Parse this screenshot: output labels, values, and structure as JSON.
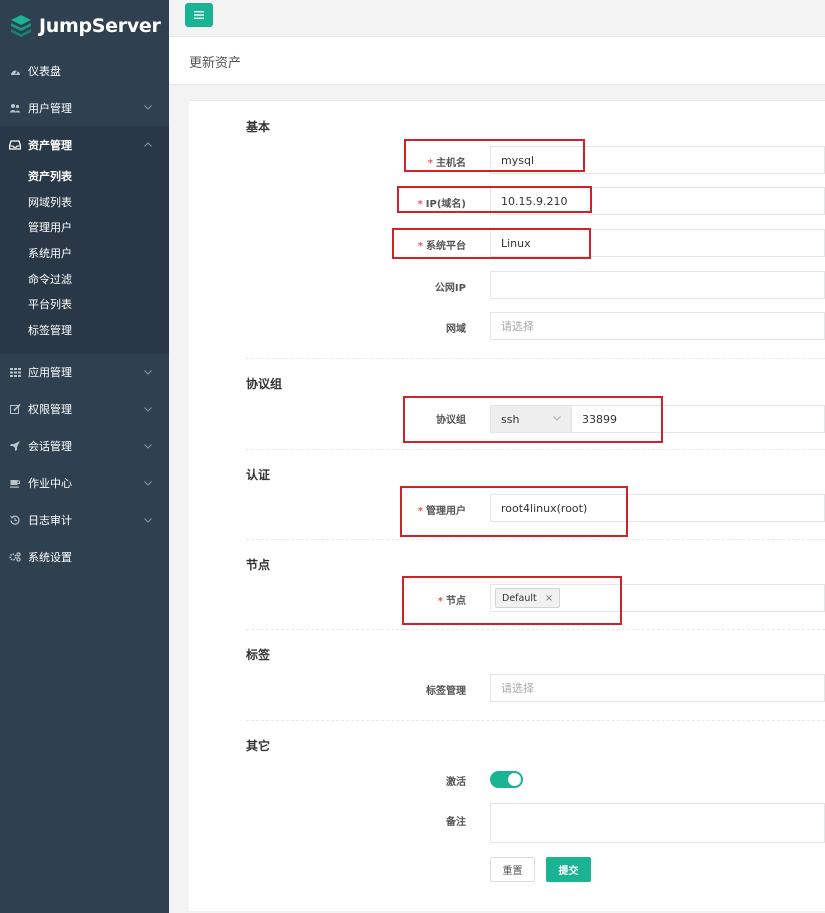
{
  "app": {
    "name": "JumpServer"
  },
  "sidebar": {
    "items": [
      {
        "label": "仪表盘",
        "icon": "dashboard-icon"
      },
      {
        "label": "用户管理",
        "icon": "users-icon",
        "expandable": true
      },
      {
        "label": "资产管理",
        "icon": "inbox-icon",
        "expandable": true,
        "expanded": true,
        "children": [
          "资产列表",
          "网域列表",
          "管理用户",
          "系统用户",
          "命令过滤",
          "平台列表",
          "标签管理"
        ],
        "current": "资产列表"
      },
      {
        "label": "应用管理",
        "icon": "grid-icon",
        "expandable": true
      },
      {
        "label": "权限管理",
        "icon": "edit-icon",
        "expandable": true
      },
      {
        "label": "会话管理",
        "icon": "rocket-icon",
        "expandable": true
      },
      {
        "label": "作业中心",
        "icon": "coffee-icon",
        "expandable": true
      },
      {
        "label": "日志审计",
        "icon": "history-icon",
        "expandable": true
      },
      {
        "label": "系统设置",
        "icon": "gears-icon"
      }
    ]
  },
  "topbar": {
    "toggle_icon": "menu-icon"
  },
  "page": {
    "title": "更新资产"
  },
  "form": {
    "sections": {
      "basic": "基本",
      "protocols": "协议组",
      "auth": "认证",
      "nodes": "节点",
      "labels": "标签",
      "other": "其它"
    },
    "required_mark": "*",
    "hostname": {
      "label": "主机名",
      "value": "mysql",
      "required": true
    },
    "ip": {
      "label": "IP(域名)",
      "value": "10.15.9.210",
      "required": true
    },
    "platform": {
      "label": "系统平台",
      "value": "Linux",
      "required": true
    },
    "public_ip": {
      "label": "公网IP",
      "value": ""
    },
    "domain": {
      "label": "网域",
      "placeholder": "请选择"
    },
    "protocol": {
      "label": "协议组",
      "name": "ssh",
      "port": "33899"
    },
    "admin_user": {
      "label": "管理用户",
      "value": "root4linux(root)",
      "required": true
    },
    "node": {
      "label": "节点",
      "tags": [
        "Default"
      ],
      "remove_glyph": "×",
      "required": true
    },
    "label_mgmt": {
      "label": "标签管理",
      "placeholder": "请选择"
    },
    "active": {
      "label": "激活",
      "value": true
    },
    "comment": {
      "label": "备注",
      "value": ""
    },
    "buttons": {
      "reset": "重置",
      "submit": "提交"
    }
  },
  "colors": {
    "sidebar": "#2f4050",
    "accent": "#1ab394",
    "highlight": "#d0222a",
    "required": "#ed5565"
  }
}
